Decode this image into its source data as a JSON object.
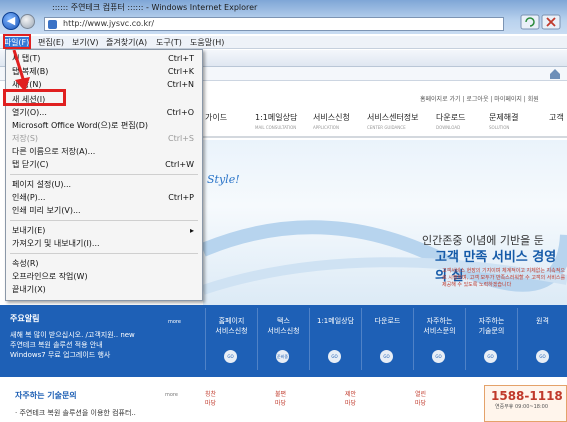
{
  "window": {
    "title": ":::::: 주연테크 컴퓨터 :::::: - Windows Internet Explorer",
    "address": "http://www.jysvc.co.kr/"
  },
  "menubar": [
    {
      "label": "파일(F)"
    },
    {
      "label": "편집(E)"
    },
    {
      "label": "보기(V)"
    },
    {
      "label": "즐겨찾기(A)"
    },
    {
      "label": "도구(T)"
    },
    {
      "label": "도움말(H)"
    }
  ],
  "file_menu": [
    {
      "label": "새 탭(T)",
      "shortcut": "Ctrl+T"
    },
    {
      "label": "탭 복제(B)",
      "shortcut": "Ctrl+K"
    },
    {
      "label": "새 창(N)",
      "shortcut": "Ctrl+N"
    },
    {
      "label": "새 세션(I)",
      "shortcut": ""
    },
    {
      "label": "열기(O)...",
      "shortcut": "Ctrl+O"
    },
    {
      "label": "Microsoft Office Word(으)로 편집(D)",
      "shortcut": ""
    },
    {
      "label": "저장(S)",
      "shortcut": "Ctrl+S"
    },
    {
      "label": "다른 이름으로 저장(A)...",
      "shortcut": ""
    },
    {
      "label": "탭 닫기(C)",
      "shortcut": "Ctrl+W"
    },
    {
      "label": "페이지 설정(U)...",
      "shortcut": ""
    },
    {
      "label": "인쇄(P)...",
      "shortcut": "Ctrl+P"
    },
    {
      "label": "인쇄 미리 보기(V)...",
      "shortcut": ""
    },
    {
      "label": "보내기(E)",
      "shortcut": "▸"
    },
    {
      "label": "가져오기 및 내보내기(I)...",
      "shortcut": ""
    },
    {
      "label": "속성(R)",
      "shortcut": ""
    },
    {
      "label": "오프라인으로 작업(W)",
      "shortcut": ""
    },
    {
      "label": "끝내기(X)",
      "shortcut": ""
    }
  ],
  "site": {
    "toplinks": "홈페이지로 가기 | 로그아웃 | 마이페이지 | 회원",
    "gnb": [
      {
        "label": "가이드",
        "sub": ""
      },
      {
        "label": "1:1메일상담",
        "sub": "MAIL CONSULTATION"
      },
      {
        "label": "서비스신청",
        "sub": "APPLICATION"
      },
      {
        "label": "서비스센터정보",
        "sub": "CENTER GUIDANCE"
      },
      {
        "label": "다운로드",
        "sub": "DOWNLOAD"
      },
      {
        "label": "문제해결",
        "sub": "SOLUTION"
      },
      {
        "label": "고객",
        "sub": ""
      }
    ],
    "style_text": "Style!",
    "hero_line1": "인간존중 이념에 기반을 둔",
    "hero_line2": "고객 만족 서비스 경영의 실",
    "hero_desc": "고객서비스 현장의 기지이며 체계적이고 지체없는 지속적으로 시행하며, 고객 모두가 만족스러워할 수 고객의 서비스를 제공해 수 있도록 노력하겠습니다",
    "notice_title": "주요알림",
    "notice_more": "more",
    "notices": [
      "새해 복 많이 받으십시오. /고객지원.. new",
      "주연테크 복원 솔루션 적용 안내",
      "Windows7 무료 업그레이드 행사"
    ],
    "band_items": [
      {
        "line1": "홈페이지",
        "line2": "서비스신청",
        "btn": "GO"
      },
      {
        "line1": "택스",
        "line2": "서비스신청",
        "btn": "준비중"
      },
      {
        "line1": "1:1메일상담",
        "line2": "",
        "btn": "GO"
      },
      {
        "line1": "다운로드",
        "line2": "",
        "btn": "GO"
      },
      {
        "line1": "자주하는",
        "line2": "서비스문의",
        "btn": "GO"
      },
      {
        "line1": "자주하는",
        "line2": "기술문의",
        "btn": "GO"
      },
      {
        "line1": "원격",
        "line2": "",
        "btn": "GO"
      }
    ],
    "faq_title": "자주하는 기술문의",
    "faq_more": "more",
    "faq_item": "· 주연테크 복원 솔루션을 이용한 컴퓨터..",
    "bottom_boxes": [
      {
        "l1": "칭찬",
        "l2": "마당"
      },
      {
        "l1": "불편",
        "l2": "마당"
      },
      {
        "l1": "제안",
        "l2": "마당"
      },
      {
        "l1": "열린",
        "l2": "마당"
      }
    ],
    "phone": "1588-1118",
    "phone_hours": "연중무휴 09:00~18:00"
  }
}
